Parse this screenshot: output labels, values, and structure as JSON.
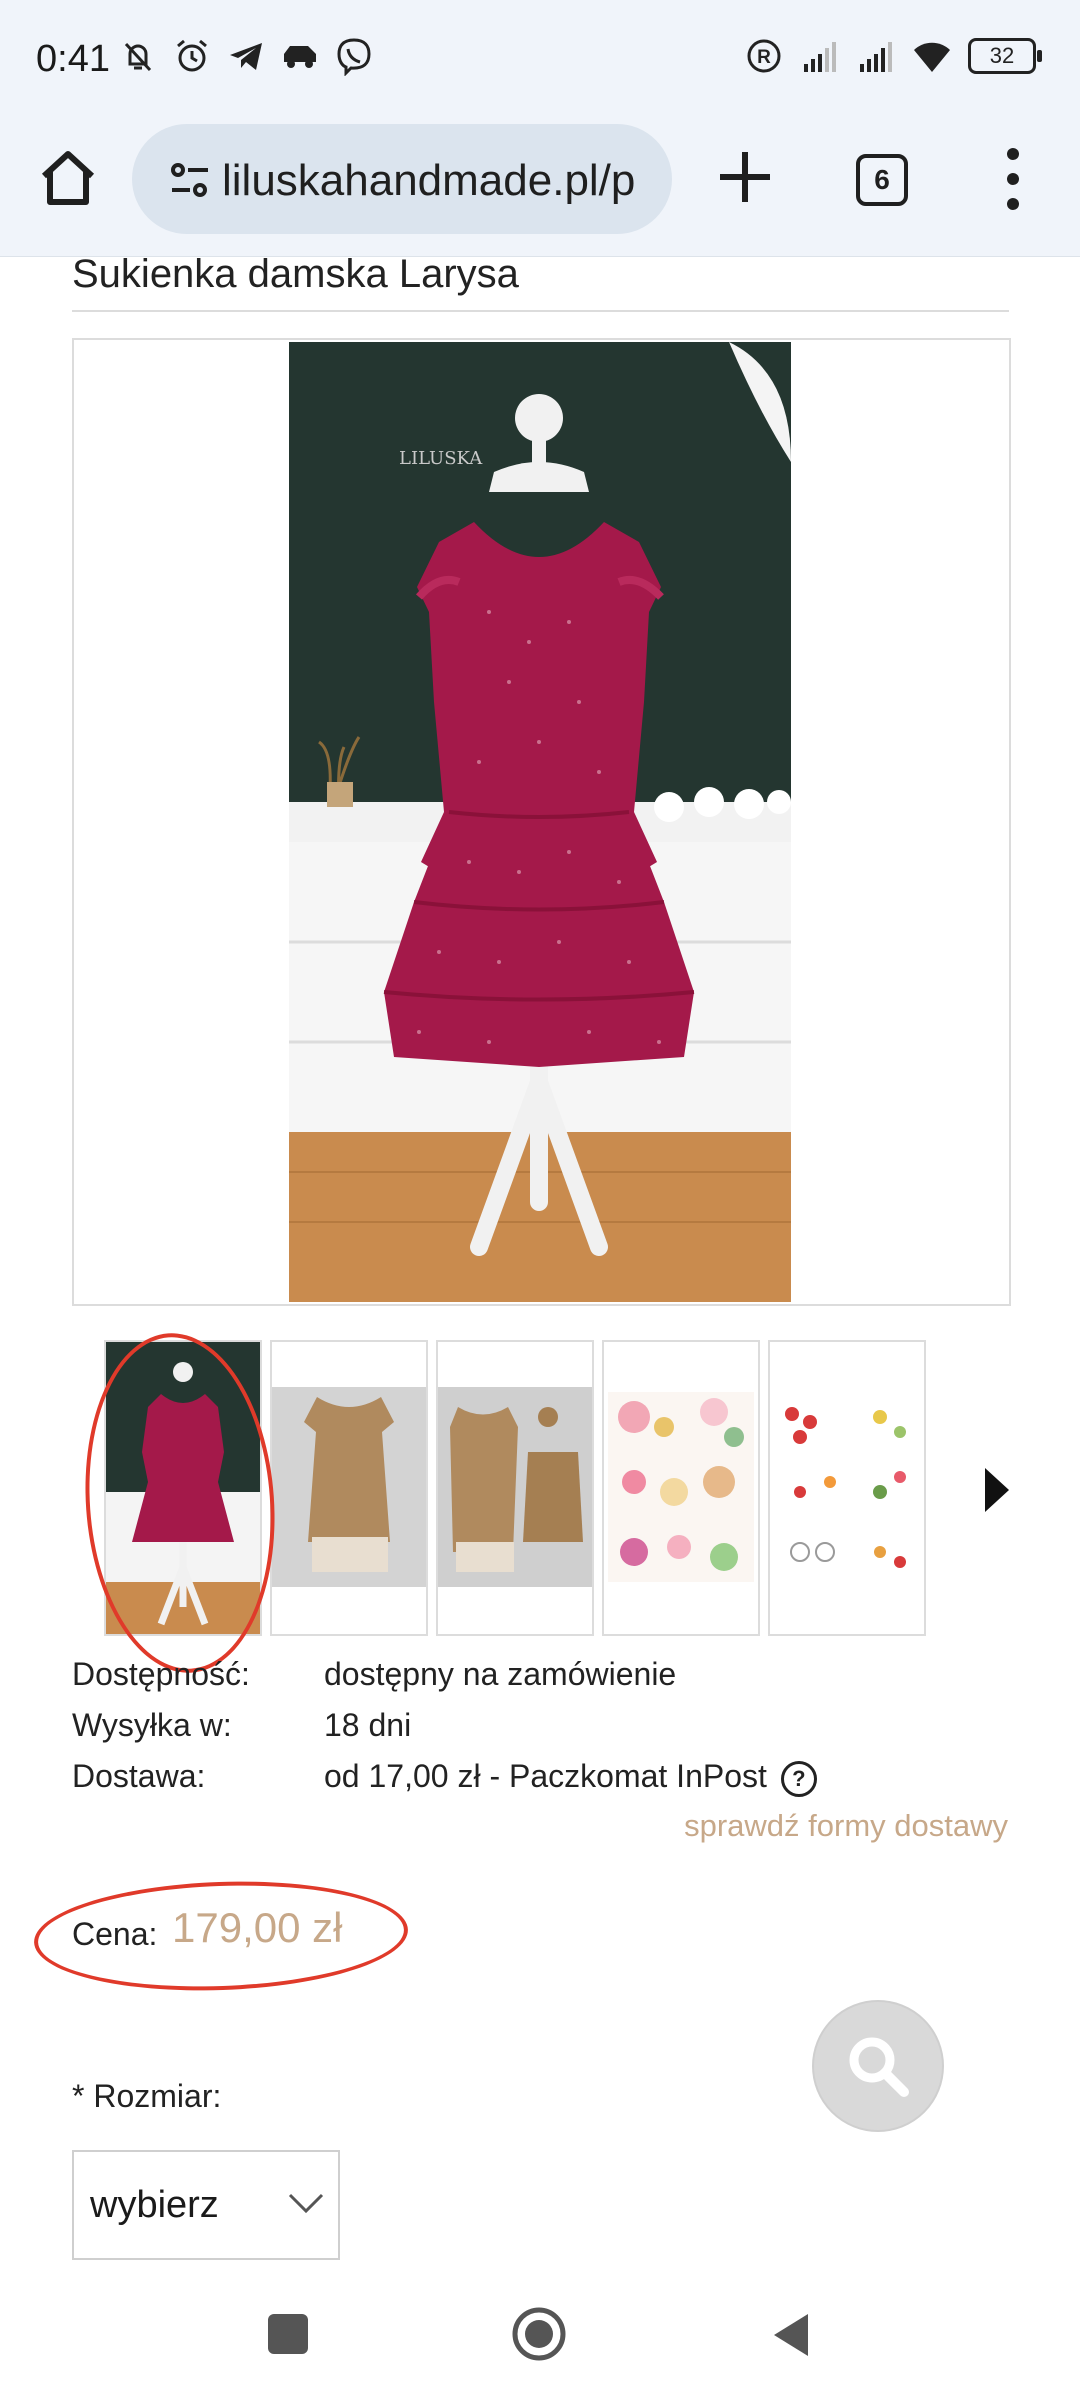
{
  "status_bar": {
    "time": "0:41",
    "battery": "32",
    "icons_left": [
      "muted-bell-icon",
      "alarm-icon",
      "telegram-icon",
      "car-icon",
      "viber-icon"
    ],
    "icons_right": [
      "registered-icon",
      "signal-icon",
      "signal-icon",
      "wifi-icon",
      "battery-icon"
    ]
  },
  "browser": {
    "url": "liluskahandmade.pl/p",
    "tab_count": "6"
  },
  "product": {
    "title": "Sukienka damska Larysa",
    "image_watermark": "LILUSKA",
    "thumbnails": [
      "red-dress-thumbnail",
      "beige-dress-front-thumbnail",
      "beige-dress-set-thumbnail",
      "floral-patterns-thumbnail",
      "fruit-patterns-thumbnail"
    ],
    "details": [
      {
        "label": "Dostępność:",
        "value": "dostępny na zamówienie"
      },
      {
        "label": "Wysyłka w:",
        "value": "18 dni"
      },
      {
        "label": "Dostawa:",
        "value": "od 17,00 zł - Paczkomat InPost"
      }
    ],
    "delivery_link": "sprawdź formy dostawy",
    "price_label": "Cena:",
    "price": "179,00 zł",
    "size_label": "* Rozmiar:",
    "size_value": "wybierz"
  },
  "colors": {
    "accent": "#c7a889",
    "annotation": "#e03a2a",
    "dress": "#a4194a"
  }
}
